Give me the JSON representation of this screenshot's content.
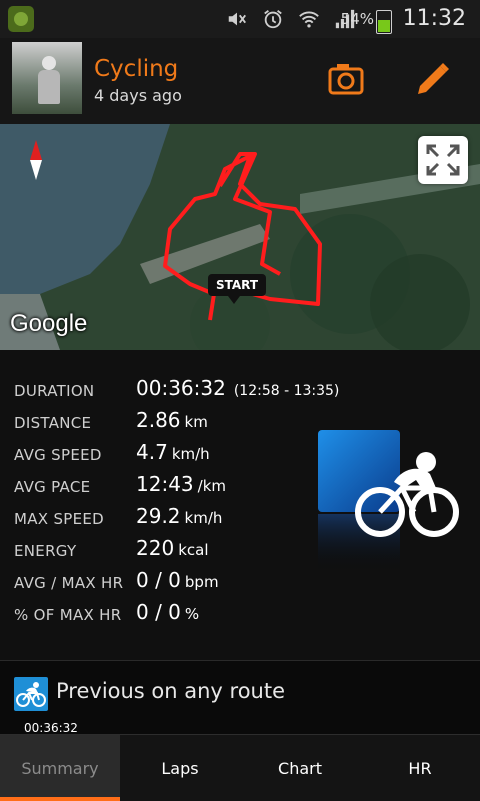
{
  "status_bar": {
    "battery_percent": "54%",
    "battery_level": 0.54,
    "time": "11:32",
    "icons": [
      "app-icon",
      "mute-icon",
      "alarm-icon",
      "wifi-icon",
      "signal-icon",
      "battery-icon"
    ]
  },
  "header": {
    "title": "Cycling",
    "subtitle": "4 days ago",
    "icons": [
      "avatar",
      "camera-icon",
      "edit-pencil-icon"
    ],
    "accent_color": "#f07a1a"
  },
  "map": {
    "start_label": "START",
    "provider_logo": "Google",
    "route_color": "#ff1d1d",
    "icons": [
      "compass-icon",
      "expand-icon"
    ]
  },
  "stats": [
    {
      "label": "DURATION",
      "value": "00:36:32",
      "unit": "",
      "extra": "(12:58 - 13:35)"
    },
    {
      "label": "DISTANCE",
      "value": "2.86",
      "unit": "km",
      "extra": ""
    },
    {
      "label": "AVG SPEED",
      "value": "4.7",
      "unit": "km/h",
      "extra": ""
    },
    {
      "label": "AVG PACE",
      "value": "12:43",
      "unit": "/km",
      "extra": ""
    },
    {
      "label": "MAX SPEED",
      "value": "29.2",
      "unit": "km/h",
      "extra": ""
    },
    {
      "label": "ENERGY",
      "value": "220",
      "unit": "kcal",
      "extra": ""
    },
    {
      "label": "AVG / MAX HR",
      "value": "0 / 0",
      "unit": "bpm",
      "extra": ""
    },
    {
      "label": "% OF MAX HR",
      "value": "0 / 0",
      "unit": "%",
      "extra": ""
    }
  ],
  "sport_icon": "cycling-icon",
  "previous": {
    "title": "Previous on any route",
    "time": "00:36:32",
    "icon": "cycling-small-icon"
  },
  "tabs": [
    {
      "label": "Summary",
      "active": true
    },
    {
      "label": "Laps",
      "active": false
    },
    {
      "label": "Chart",
      "active": false
    },
    {
      "label": "HR",
      "active": false
    }
  ],
  "colors": {
    "tab_indicator": "#ff6e19",
    "sport_blue": "#1f8fd6"
  }
}
